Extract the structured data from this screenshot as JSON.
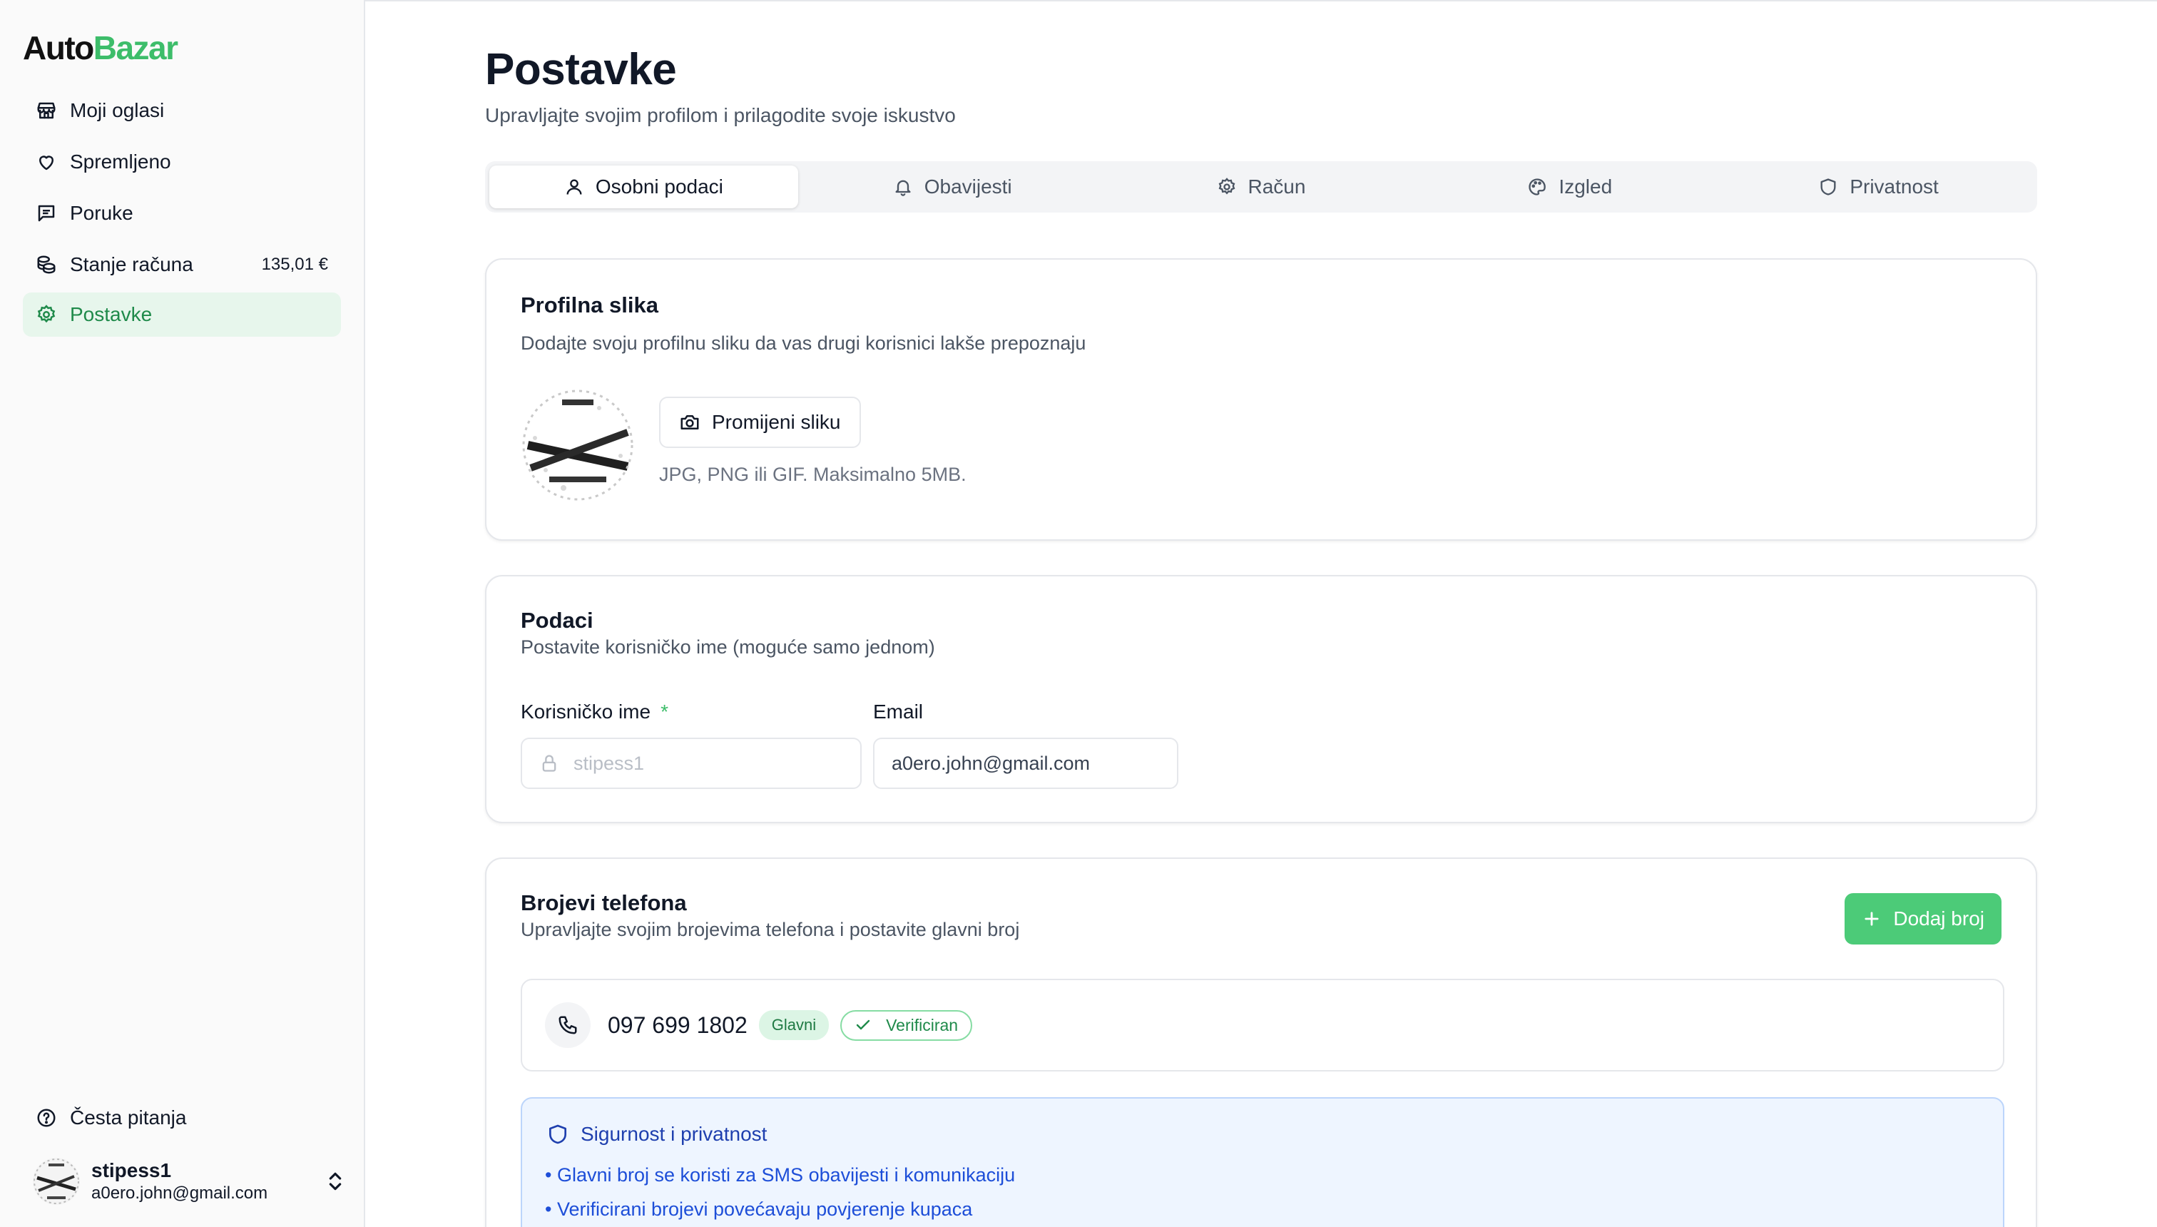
{
  "app": {
    "logo_part1": "Auto",
    "logo_part2": "Bazar"
  },
  "sidebar": {
    "items": [
      {
        "label": "Moji oglasi",
        "icon": "store-icon"
      },
      {
        "label": "Spremljeno",
        "icon": "heart-icon"
      },
      {
        "label": "Poruke",
        "icon": "message-icon"
      },
      {
        "label": "Stanje računa",
        "icon": "coins-icon",
        "badge": "135,01 €"
      },
      {
        "label": "Postavke",
        "icon": "gear-icon",
        "active": true
      }
    ],
    "faq": "Česta pitanja",
    "user": {
      "name": "stipess1",
      "email": "a0ero.john@gmail.com"
    }
  },
  "page": {
    "title": "Postavke",
    "subtitle": "Upravljajte svojim profilom i prilagodite svoje iskustvo"
  },
  "tabs": [
    {
      "label": "Osobni podaci",
      "icon": "user-icon",
      "active": true
    },
    {
      "label": "Obavijesti",
      "icon": "bell-icon"
    },
    {
      "label": "Račun",
      "icon": "gear-icon"
    },
    {
      "label": "Izgled",
      "icon": "palette-icon"
    },
    {
      "label": "Privatnost",
      "icon": "shield-icon"
    }
  ],
  "profile_card": {
    "title": "Profilna slika",
    "subtitle": "Dodajte svoju profilnu sliku da vas drugi korisnici lakše prepoznaju",
    "button": "Promijeni sliku",
    "hint": "JPG, PNG ili GIF. Maksimalno 5MB."
  },
  "details_card": {
    "title": "Podaci",
    "subtitle": "Postavite korisničko ime (moguće samo jednom)",
    "username_label": "Korisničko ime",
    "required_mark": "*",
    "username_value": "stipess1",
    "email_label": "Email",
    "email_value": "a0ero.john@gmail.com"
  },
  "phones_card": {
    "title": "Brojevi telefona",
    "subtitle": "Upravljajte svojim brojevima telefona i postavite glavni broj",
    "add_button": "Dodaj broj",
    "phones": [
      {
        "number": "097 699 1802",
        "main_badge": "Glavni",
        "verified_badge": "Verificiran"
      }
    ],
    "info": {
      "title": "Sigurnost i privatnost",
      "items": [
        "• Glavni broj se koristi za SMS obavijesti i komunikaciju",
        "• Verificirani brojevi povećavaju povjerenje kupaca"
      ]
    }
  },
  "colors": {
    "accent": "#3dbd6a",
    "button_green": "#4ccb78",
    "info_blue": "#1d4ed8"
  }
}
